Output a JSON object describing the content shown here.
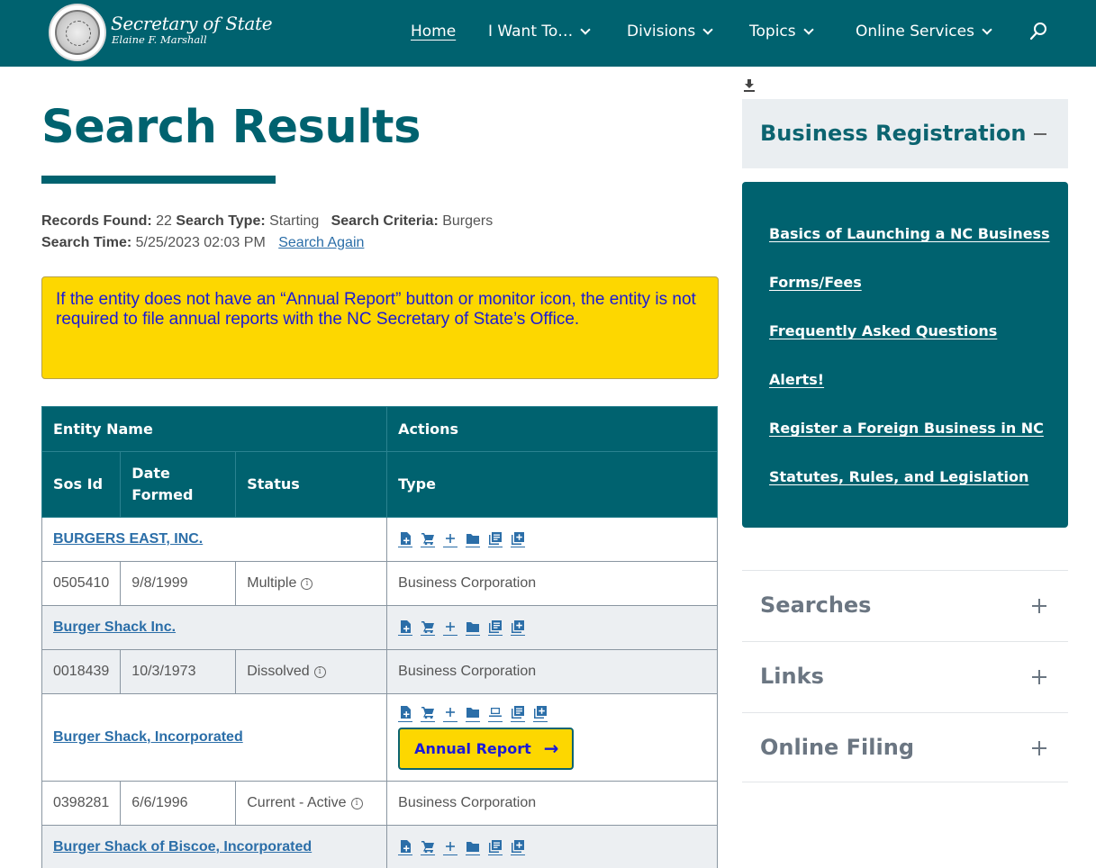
{
  "header": {
    "brand_title": "Secretary of State",
    "brand_subtitle": "Elaine F. Marshall",
    "nav": [
      {
        "label": "Home",
        "has_dropdown": false,
        "active": true
      },
      {
        "label": "I Want To…",
        "has_dropdown": true
      },
      {
        "label": "Divisions",
        "has_dropdown": true
      },
      {
        "label": "Topics",
        "has_dropdown": true
      },
      {
        "label": "Online Services",
        "has_dropdown": true
      }
    ],
    "search_icon": "search-icon"
  },
  "main": {
    "title": "Search Results",
    "meta": {
      "records_found_label": "Records Found:",
      "records_found": "22",
      "search_type_label": "Search Type:",
      "search_type": "Starting",
      "search_criteria_label": "Search Criteria:",
      "search_criteria": "Burgers",
      "search_time_label": "Search Time:",
      "search_time": "5/25/2023 02:03 PM",
      "search_again": "Search Again"
    },
    "notice": "If the entity does not have an “Annual Report” button or monitor icon, the entity is not required to file annual reports with the NC Secretary of State’s Office.",
    "table": {
      "headers": {
        "entity_name": "Entity Name",
        "actions": "Actions",
        "sos_id": "Sos Id",
        "date_formed": "Date Formed",
        "status": "Status",
        "type": "Type"
      },
      "rows": [
        {
          "name": "BURGERS EAST, INC.",
          "sos_id": "0505410",
          "date_formed": "9/8/1999",
          "status": "Multiple",
          "type": "Business Corporation",
          "actions": [
            "file-add-icon",
            "cart-icon",
            "plus-icon",
            "folder-icon",
            "documents-icon",
            "add-copy-icon"
          ],
          "annual_report": null
        },
        {
          "name": "Burger Shack Inc.",
          "sos_id": "0018439",
          "date_formed": "10/3/1973",
          "status": "Dissolved",
          "type": "Business Corporation",
          "actions": [
            "file-add-icon",
            "cart-icon",
            "plus-icon",
            "folder-icon",
            "documents-icon",
            "add-copy-icon"
          ],
          "annual_report": null
        },
        {
          "name": "Burger Shack, Incorporated",
          "sos_id": "0398281",
          "date_formed": "6/6/1996",
          "status": "Current - Active",
          "type": "Business Corporation",
          "actions": [
            "file-add-icon",
            "cart-icon",
            "plus-icon",
            "folder-icon",
            "monitor-icon",
            "documents-icon",
            "add-copy-icon"
          ],
          "annual_report": "Annual Report"
        },
        {
          "name": "Burger Shack of Biscoe, Incorporated",
          "actions": [
            "file-add-icon",
            "cart-icon",
            "plus-icon",
            "folder-icon",
            "documents-icon",
            "add-copy-icon"
          ],
          "annual_report": null
        }
      ]
    }
  },
  "sidebar": {
    "download_icon": "download-icon",
    "open_section": {
      "title": "Business Registration",
      "links": [
        "Basics of Launching a NC Business",
        "Forms/Fees",
        "Frequently Asked Questions",
        "Alerts!",
        "Register a Foreign Business in NC",
        "Statutes, Rules, and Legislation"
      ]
    },
    "collapsed_sections": [
      "Searches",
      "Links",
      "Online Filing"
    ]
  },
  "colors": {
    "brand_teal": "#00626f",
    "notice_yellow": "#fdd700",
    "link_blue": "#2b6ea8",
    "notice_text": "#1a1ad8"
  }
}
